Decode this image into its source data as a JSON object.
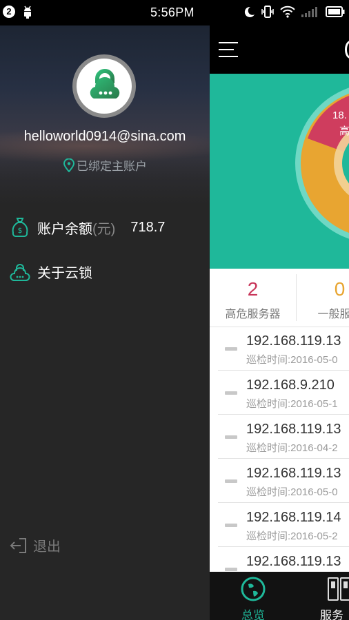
{
  "status_bar": {
    "notification_count": "2",
    "time": "5:56PM",
    "icons": [
      "android-icon",
      "moon-icon",
      "vibrate-icon",
      "wifi-icon",
      "signal-icon",
      "battery-icon"
    ]
  },
  "drawer": {
    "avatar_icon": "cloud-lock-icon",
    "email": "helloworld0914@sina.com",
    "bound_status": "已绑定主账户",
    "balance": {
      "label": "账户余额",
      "unit": "(元)",
      "value": "718.7"
    },
    "about": {
      "label": "关于云锁"
    },
    "logout": {
      "label": "退出"
    }
  },
  "main": {
    "menu_icon": "hamburger-icon",
    "chart": {
      "label_value": "18.",
      "label_text": "高"
    },
    "stats": [
      {
        "value": "2",
        "label": "高危服务器",
        "color": "#c8365a"
      },
      {
        "value": "0",
        "label": "一般服务",
        "color": "#e8a531"
      }
    ],
    "servers": [
      {
        "ip": "192.168.119.13",
        "time": "巡检时间:2016-05-0"
      },
      {
        "ip": "192.168.9.210",
        "time": "巡检时间:2016-05-1"
      },
      {
        "ip": "192.168.119.13",
        "time": "巡检时间:2016-04-2"
      },
      {
        "ip": "192.168.119.13",
        "time": "巡检时间:2016-05-0"
      },
      {
        "ip": "192.168.119.14",
        "time": "巡检时间:2016-05-2"
      },
      {
        "ip": "192.168.119.13",
        "time": ""
      }
    ],
    "bottom_nav": [
      {
        "label": "总览",
        "icon": "globe-icon",
        "color": "#1fb89a"
      },
      {
        "label": "服务",
        "icon": "server-icon",
        "color": "#ffffff"
      }
    ]
  },
  "colors": {
    "accent": "#1fb89a",
    "danger": "#c8365a",
    "warning": "#e8a531"
  }
}
